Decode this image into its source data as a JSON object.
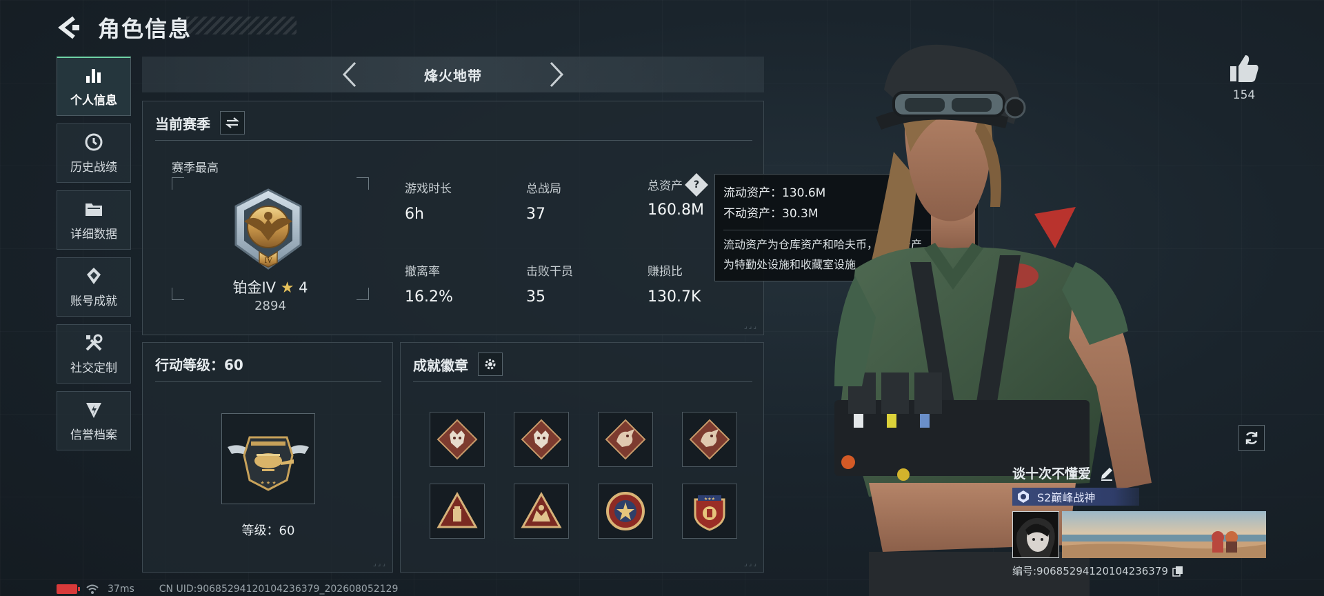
{
  "header": {
    "title": "角色信息",
    "back_icon": "back-arrow-icon"
  },
  "sidebar": {
    "items": [
      {
        "label": "个人信息",
        "icon": "bar-chart-icon",
        "active": true
      },
      {
        "label": "历史战绩",
        "icon": "history-clock-icon",
        "active": false
      },
      {
        "label": "详细数据",
        "icon": "folder-icon",
        "active": false
      },
      {
        "label": "账号成就",
        "icon": "achievement-icon",
        "active": false
      },
      {
        "label": "社交定制",
        "icon": "tools-icon",
        "active": false
      },
      {
        "label": "信誉档案",
        "icon": "reputation-icon",
        "active": false
      }
    ]
  },
  "mode_selector": {
    "title": "烽火地带"
  },
  "season": {
    "title": "当前赛季",
    "best_label": "赛季最高",
    "rank_name": "铂金IV",
    "rank_star": "★",
    "rank_stars": "4",
    "rank_score": "2894",
    "stats": [
      {
        "label": "游戏时长",
        "value": "6h"
      },
      {
        "label": "总战局",
        "value": "37"
      },
      {
        "label": "总资产",
        "value": "160.8M",
        "help": true
      },
      {
        "label": "撤离率",
        "value": "16.2%"
      },
      {
        "label": "击败干员",
        "value": "35"
      },
      {
        "label": "赚损比",
        "value": "130.7K"
      }
    ]
  },
  "tooltip": {
    "liquid": "流动资产：130.6M",
    "fixed": "不动资产：30.3M",
    "desc_line1": "流动资产为仓库资产和哈夫币，不动资产",
    "desc_line2": "为特勤处设施和收藏室设施"
  },
  "action_level": {
    "title": "行动等级：60",
    "level_text": "等级：60"
  },
  "achievements": {
    "title": "成就徽章",
    "badges": [
      "wolf-badge-1",
      "wolf-badge-2",
      "dragon-badge-1",
      "dragon-badge-2",
      "triangle-badge-1",
      "triangle-badge-2",
      "round-badge-1",
      "shield-badge-1"
    ]
  },
  "likes": {
    "count": "154"
  },
  "profile": {
    "name": "谈十次不懂爱",
    "title_badge": "S2巅峰战神",
    "uid_label": "编号:90685294120104236379"
  },
  "status": {
    "ping": "37ms",
    "uid": "CN UID:90685294120104236379_202608052129"
  },
  "colors": {
    "accent": "#6fd3a6",
    "bg": "#1a242c",
    "badge_red": "#9c4a3c",
    "gold": "#e6c15b"
  }
}
